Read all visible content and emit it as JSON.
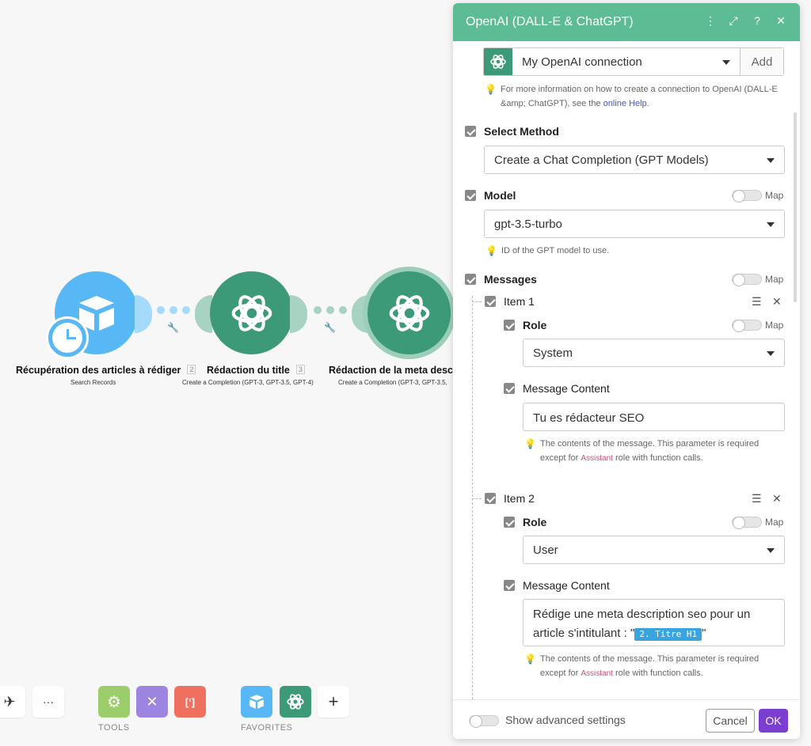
{
  "scenario": {
    "modules": [
      {
        "title": "Récupération des articles à rédiger",
        "number": "2",
        "subtitle": "Search Records",
        "app": "airtable"
      },
      {
        "title": "Rédaction du title",
        "number": "3",
        "subtitle": "Create a Completion (GPT-3, GPT-3.5, GPT-4)",
        "app": "openai"
      },
      {
        "title": "Rédaction de la meta desc",
        "subtitle": "Create a Completion (GPT-3, GPT-3.5,",
        "app": "openai"
      }
    ]
  },
  "toolbar": {
    "more_label": "···",
    "plus_label": "+",
    "tools_label": "TOOLS",
    "favorites_label": "FAVORITES",
    "tools_colors": [
      "#9ccd6a",
      "#9b85e0",
      "#f07060"
    ],
    "favorites_colors": [
      "#58b8f5",
      "#3d9a78"
    ]
  },
  "panel": {
    "title": "OpenAI (DALL-E & ChatGPT)",
    "header_color": "#5ebc94",
    "connection": {
      "value": "My OpenAI connection",
      "add_label": "Add",
      "hint_text": "For more information on how to create a connection to OpenAI (DALL-E &amp; ChatGPT), see the ",
      "hint_link": "online Help",
      "hint_end": "."
    },
    "select_method": {
      "label": "Select Method",
      "value": "Create a Chat Completion (GPT Models)"
    },
    "model": {
      "label": "Model",
      "map_label": "Map",
      "value": "gpt-3.5-turbo",
      "hint": "ID of the GPT model to use."
    },
    "messages": {
      "label": "Messages",
      "map_label": "Map",
      "items": [
        {
          "title": "Item 1",
          "role_label": "Role",
          "role_map_label": "Map",
          "role_value": "System",
          "content_label": "Message Content",
          "content_value": "Tu es rédacteur SEO",
          "hint_a": "The contents of the message. This parameter is required except for ",
          "hint_pink": "Assistant",
          "hint_b": " role with function calls."
        },
        {
          "title": "Item 2",
          "role_label": "Role",
          "role_map_label": "Map",
          "role_value": "User",
          "content_label": "Message Content",
          "content_pre": "Rédige une meta description seo pour un article s'intitulant : \"",
          "content_chip": "2. Titre H1",
          "content_post": "\"",
          "hint_a": "The contents of the message. This parameter is required except for ",
          "hint_pink": "Assistant",
          "hint_b": " role with function calls."
        }
      ]
    },
    "footer": {
      "advanced_label": "Show advanced settings",
      "cancel_label": "Cancel",
      "ok_label": "OK",
      "ok_color": "#7a3fd0"
    }
  }
}
